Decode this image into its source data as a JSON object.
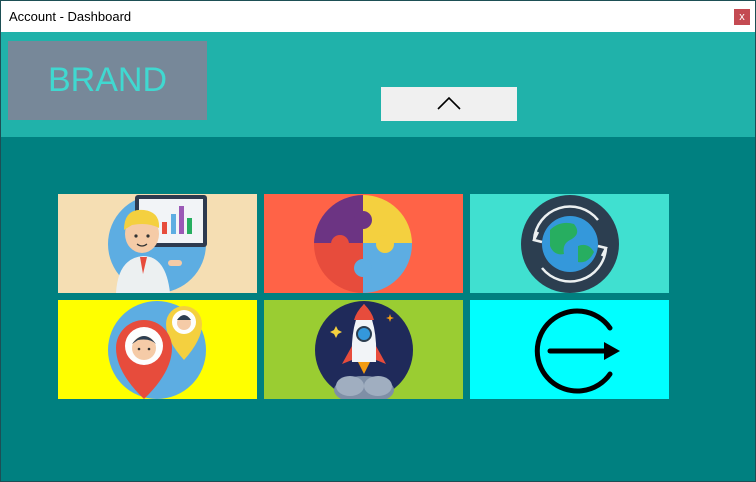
{
  "window": {
    "title": "Account - Dashboard",
    "close_glyph": "x"
  },
  "header": {
    "brand_label": "BRAND",
    "collapse_icon": "chevron-up-icon"
  },
  "tiles": [
    {
      "id": "presentation",
      "icon": "presenter-chart-icon",
      "color": "#f5deb3"
    },
    {
      "id": "puzzle",
      "icon": "puzzle-icon",
      "color": "#ff6347"
    },
    {
      "id": "globe",
      "icon": "globe-sync-icon",
      "color": "#40e0d0"
    },
    {
      "id": "location",
      "icon": "location-people-icon",
      "color": "#ffff00"
    },
    {
      "id": "rocket",
      "icon": "rocket-icon",
      "color": "#9acd32"
    },
    {
      "id": "logout",
      "icon": "logout-icon",
      "color": "#00ffff"
    }
  ],
  "colors": {
    "header": "#20b2aa",
    "content": "#008080",
    "brand_box": "#778899",
    "brand_text": "#40d8d0",
    "close_button": "#c44a52"
  }
}
